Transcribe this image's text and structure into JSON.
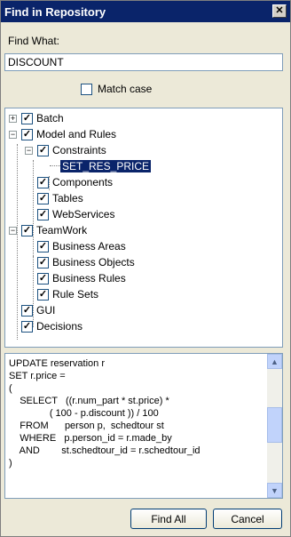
{
  "window": {
    "title": "Find in Repository"
  },
  "find": {
    "label": "Find What:",
    "value": "DISCOUNT"
  },
  "match_case": {
    "label": "Match case",
    "checked": false
  },
  "tree": {
    "items": [
      {
        "label": "Batch",
        "level": 0,
        "expander": "+",
        "checked": true
      },
      {
        "label": "Model and Rules",
        "level": 0,
        "expander": "−",
        "checked": true
      },
      {
        "label": "Constraints",
        "level": 1,
        "expander": "−",
        "checked": true
      },
      {
        "label": "SET_RES_PRICE",
        "level": 2,
        "selected": true
      },
      {
        "label": "Components",
        "level": 1,
        "checked": true
      },
      {
        "label": "Tables",
        "level": 1,
        "checked": true
      },
      {
        "label": "WebServices",
        "level": 1,
        "checked": true
      },
      {
        "label": "TeamWork",
        "level": 0,
        "expander": "−",
        "checked": true
      },
      {
        "label": "Business Areas",
        "level": 1,
        "checked": true
      },
      {
        "label": "Business Objects",
        "level": 1,
        "checked": true
      },
      {
        "label": "Business Rules",
        "level": 1,
        "checked": true
      },
      {
        "label": "Rule Sets",
        "level": 1,
        "checked": true
      },
      {
        "label": "GUI",
        "level": 0,
        "checked": true
      },
      {
        "label": "Decisions",
        "level": 0,
        "checked": true
      }
    ]
  },
  "sql": {
    "text": "UPDATE reservation r\nSET r.price =\n(\n    SELECT   ((r.num_part * st.price) *\n               ( 100 - p.discount )) / 100\n    FROM      person p,  schedtour st\n    WHERE   p.person_id = r.made_by\n    AND        st.schedtour_id = r.schedtour_id\n)"
  },
  "buttons": {
    "find_all": "Find All",
    "cancel": "Cancel"
  }
}
